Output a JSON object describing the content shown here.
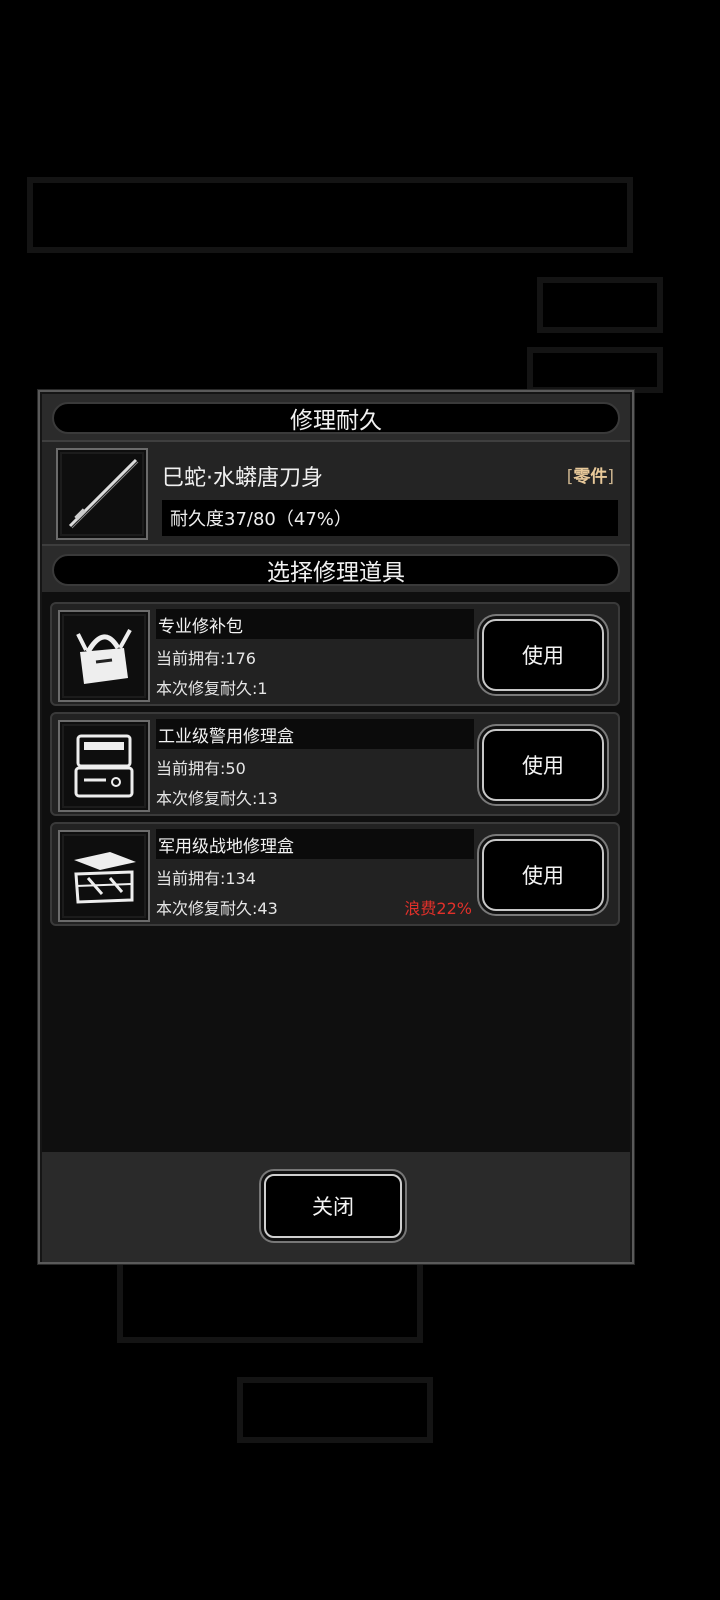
{
  "header": {
    "title": "修理耐久"
  },
  "item": {
    "name": "巳蛇·水蟒唐刀身",
    "tag_open": "[",
    "tag": "零件",
    "tag_close": "]",
    "durability_text": "耐久度37/80（47%）",
    "durability_current": 37,
    "durability_max": 80
  },
  "tools_section": {
    "title": "选择修理道具"
  },
  "tools": [
    {
      "name": "专业修补包",
      "owned": "当前拥有:176",
      "repair": "本次修复耐久:1",
      "waste": "",
      "button": "使用",
      "icon": "repair-kit-bag-icon"
    },
    {
      "name": "工业级警用修理盒",
      "owned": "当前拥有:50",
      "repair": "本次修复耐久:13",
      "waste": "",
      "button": "使用",
      "icon": "repair-case-icon"
    },
    {
      "name": "军用级战地修理盒",
      "owned": "当前拥有:134",
      "repair": "本次修复耐久:43",
      "waste": "浪费22%",
      "button": "使用",
      "icon": "toolbox-icon"
    }
  ],
  "footer": {
    "close_label": "关闭"
  },
  "colors": {
    "waste": "#e0302a",
    "tag": "#e8c99a",
    "panel": "#242424",
    "background": "#000000"
  }
}
